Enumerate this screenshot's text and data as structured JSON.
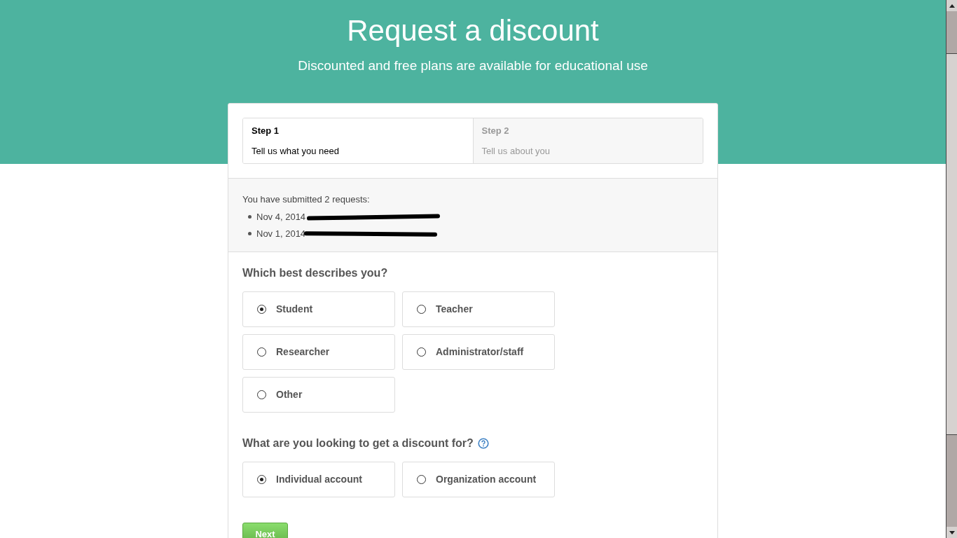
{
  "header": {
    "title": "Request a discount",
    "subtitle": "Discounted and free plans are available for educational use"
  },
  "steps": [
    {
      "title": "Step 1",
      "description": "Tell us what you need",
      "selected": true
    },
    {
      "title": "Step 2",
      "description": "Tell us about you",
      "selected": false
    }
  ],
  "requests": {
    "summary": "You have submitted 2 requests:",
    "items": [
      {
        "date": "Nov 4, 2014"
      },
      {
        "date": "Nov 1, 2014"
      }
    ]
  },
  "questions": [
    {
      "label": "Which best describes you?",
      "help": false,
      "options": [
        {
          "label": "Student",
          "selected": true
        },
        {
          "label": "Teacher",
          "selected": false
        },
        {
          "label": "Researcher",
          "selected": false
        },
        {
          "label": "Administrator/staff",
          "selected": false
        },
        {
          "label": "Other",
          "selected": false
        }
      ]
    },
    {
      "label": "What are you looking to get a discount for?",
      "help": true,
      "options": [
        {
          "label": "Individual account",
          "selected": true
        },
        {
          "label": "Organization account",
          "selected": false
        }
      ]
    }
  ],
  "next_button": "Next"
}
